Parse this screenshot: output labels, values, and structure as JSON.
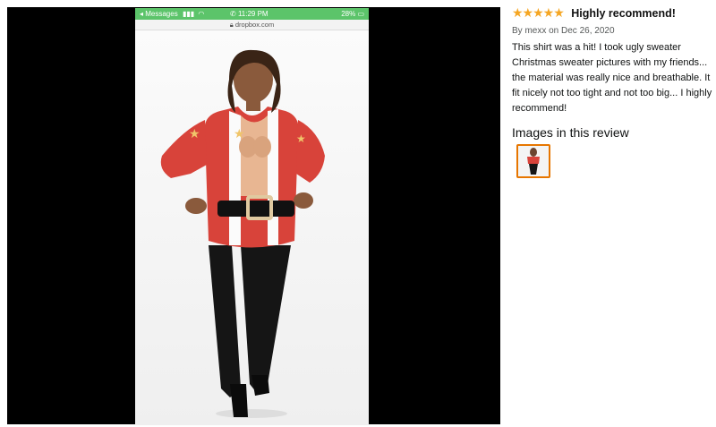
{
  "phone": {
    "status_left": "◂ Messages",
    "time": "11:29 PM",
    "battery": "28%",
    "url": "dropbox.com"
  },
  "review": {
    "rating_stars": 5,
    "stars_display": "★★★★★",
    "title": "Highly recommend!",
    "byline": "By mexx on Dec 26, 2020",
    "body": "This shirt was a hit! I took ugly sweater Christmas sweater pictures with my friends... the material was really nice and breathable. It fit nicely not too tight and not too big... I highly recommend!",
    "images_heading": "Images in this review"
  },
  "colors": {
    "star": "#f5a623",
    "status_bar": "#5cc46a",
    "thumb_border": "#e77600",
    "sweater": "#d8433a"
  },
  "icons": {
    "signal": "signal-bars-icon",
    "wifi": "wifi-icon",
    "phone": "phone-icon",
    "lock": "lock-icon",
    "battery": "battery-icon"
  }
}
